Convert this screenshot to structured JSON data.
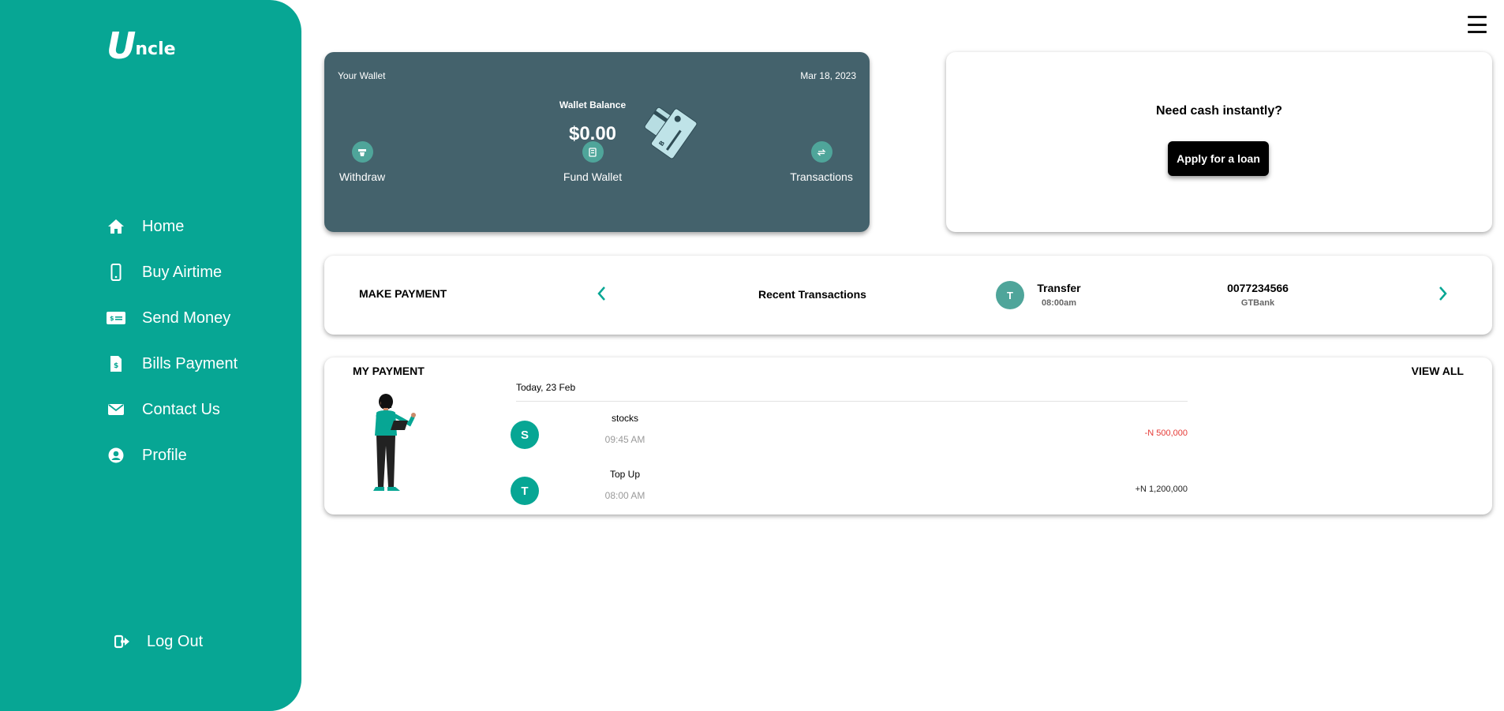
{
  "brand": {
    "logo_big": "U",
    "logo_small": "ncle"
  },
  "sidebar": {
    "items": [
      {
        "label": "Home",
        "icon": "home-icon"
      },
      {
        "label": "Buy Airtime",
        "icon": "phone-icon"
      },
      {
        "label": "Send Money",
        "icon": "money-icon"
      },
      {
        "label": "Bills Payment",
        "icon": "bill-icon"
      },
      {
        "label": "Contact Us",
        "icon": "envelope-icon"
      },
      {
        "label": "Profile",
        "icon": "user-icon"
      }
    ],
    "logout_label": "Log Out"
  },
  "wallet": {
    "title": "Your Wallet",
    "date": "Mar 18, 2023",
    "balance_label": "Wallet Balance",
    "balance": "$0.00",
    "actions": [
      {
        "label": "Withdraw",
        "icon": "withdraw-icon"
      },
      {
        "label": "Fund Wallet",
        "icon": "fund-icon"
      },
      {
        "label": "Transactions",
        "icon": "transactions-icon"
      }
    ]
  },
  "loan": {
    "question": "Need cash instantly?",
    "button_label": "Apply for a loan"
  },
  "payment_bar": {
    "make_payment_label": "MAKE PAYMENT",
    "recent_label": "Recent Transactions",
    "recent": {
      "initial": "T",
      "type": "Transfer",
      "time": "08:00am",
      "account": "0077234566",
      "bank": "GTBank"
    }
  },
  "my_payment": {
    "title": "MY PAYMENT",
    "view_all_label": "VIEW ALL",
    "date_header": "Today, 23 Feb",
    "transactions": [
      {
        "initial": "S",
        "name": "stocks",
        "time": "09:45 AM",
        "amount": "-N 500,000",
        "color": "#e53935"
      },
      {
        "initial": "T",
        "name": "Top Up",
        "time": "08:00 AM",
        "amount": "+N 1,200,000",
        "color": "#222222"
      }
    ]
  },
  "colors": {
    "primary": "#07a694",
    "wallet_bg": "#44626c",
    "action_circle": "#4fa59a",
    "negative": "#e53935"
  }
}
